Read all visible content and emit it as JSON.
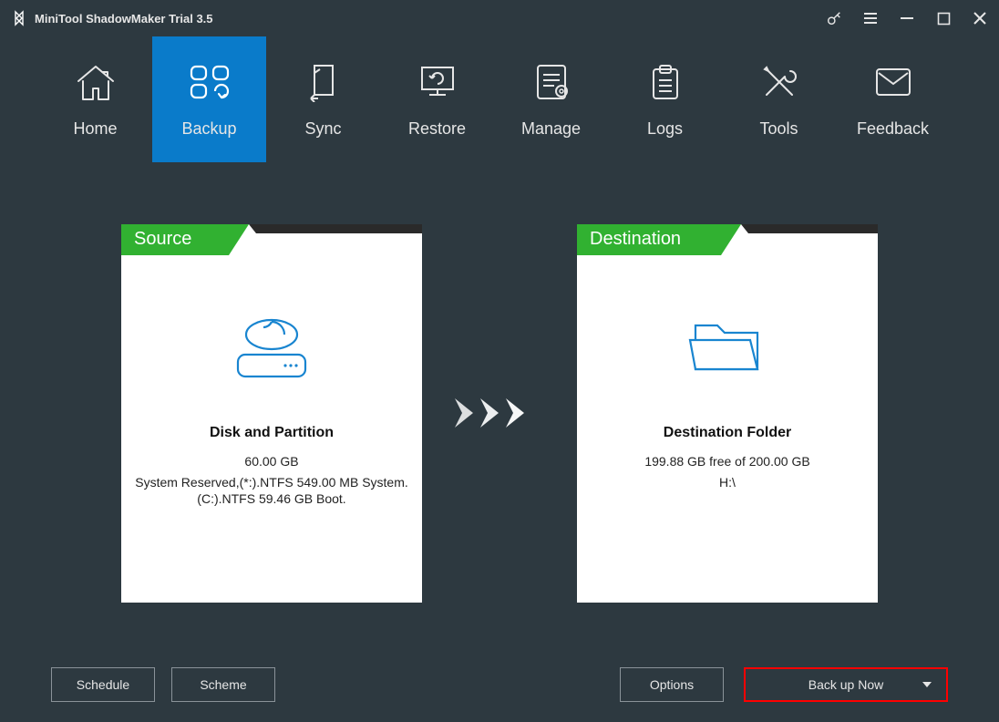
{
  "titlebar": {
    "title": "MiniTool ShadowMaker Trial 3.5"
  },
  "nav": {
    "items": [
      {
        "label": "Home",
        "icon": "home-icon"
      },
      {
        "label": "Backup",
        "icon": "backup-icon"
      },
      {
        "label": "Sync",
        "icon": "sync-icon"
      },
      {
        "label": "Restore",
        "icon": "restore-icon"
      },
      {
        "label": "Manage",
        "icon": "manage-icon"
      },
      {
        "label": "Logs",
        "icon": "logs-icon"
      },
      {
        "label": "Tools",
        "icon": "tools-icon"
      },
      {
        "label": "Feedback",
        "icon": "feedback-icon"
      }
    ],
    "active_index": 1
  },
  "source": {
    "tab": "Source",
    "title": "Disk and Partition",
    "size": "60.00 GB",
    "details": "System Reserved,(*:).NTFS 549.00 MB System.\n(C:).NTFS 59.46 GB Boot."
  },
  "destination": {
    "tab": "Destination",
    "title": "Destination Folder",
    "free": "199.88 GB free of 200.00 GB",
    "path": "H:\\"
  },
  "footer": {
    "schedule": "Schedule",
    "scheme": "Scheme",
    "options": "Options",
    "backup_now": "Back up Now"
  },
  "colors": {
    "accent": "#0a7bca",
    "green": "#31b131",
    "highlight": "#ff0000"
  }
}
